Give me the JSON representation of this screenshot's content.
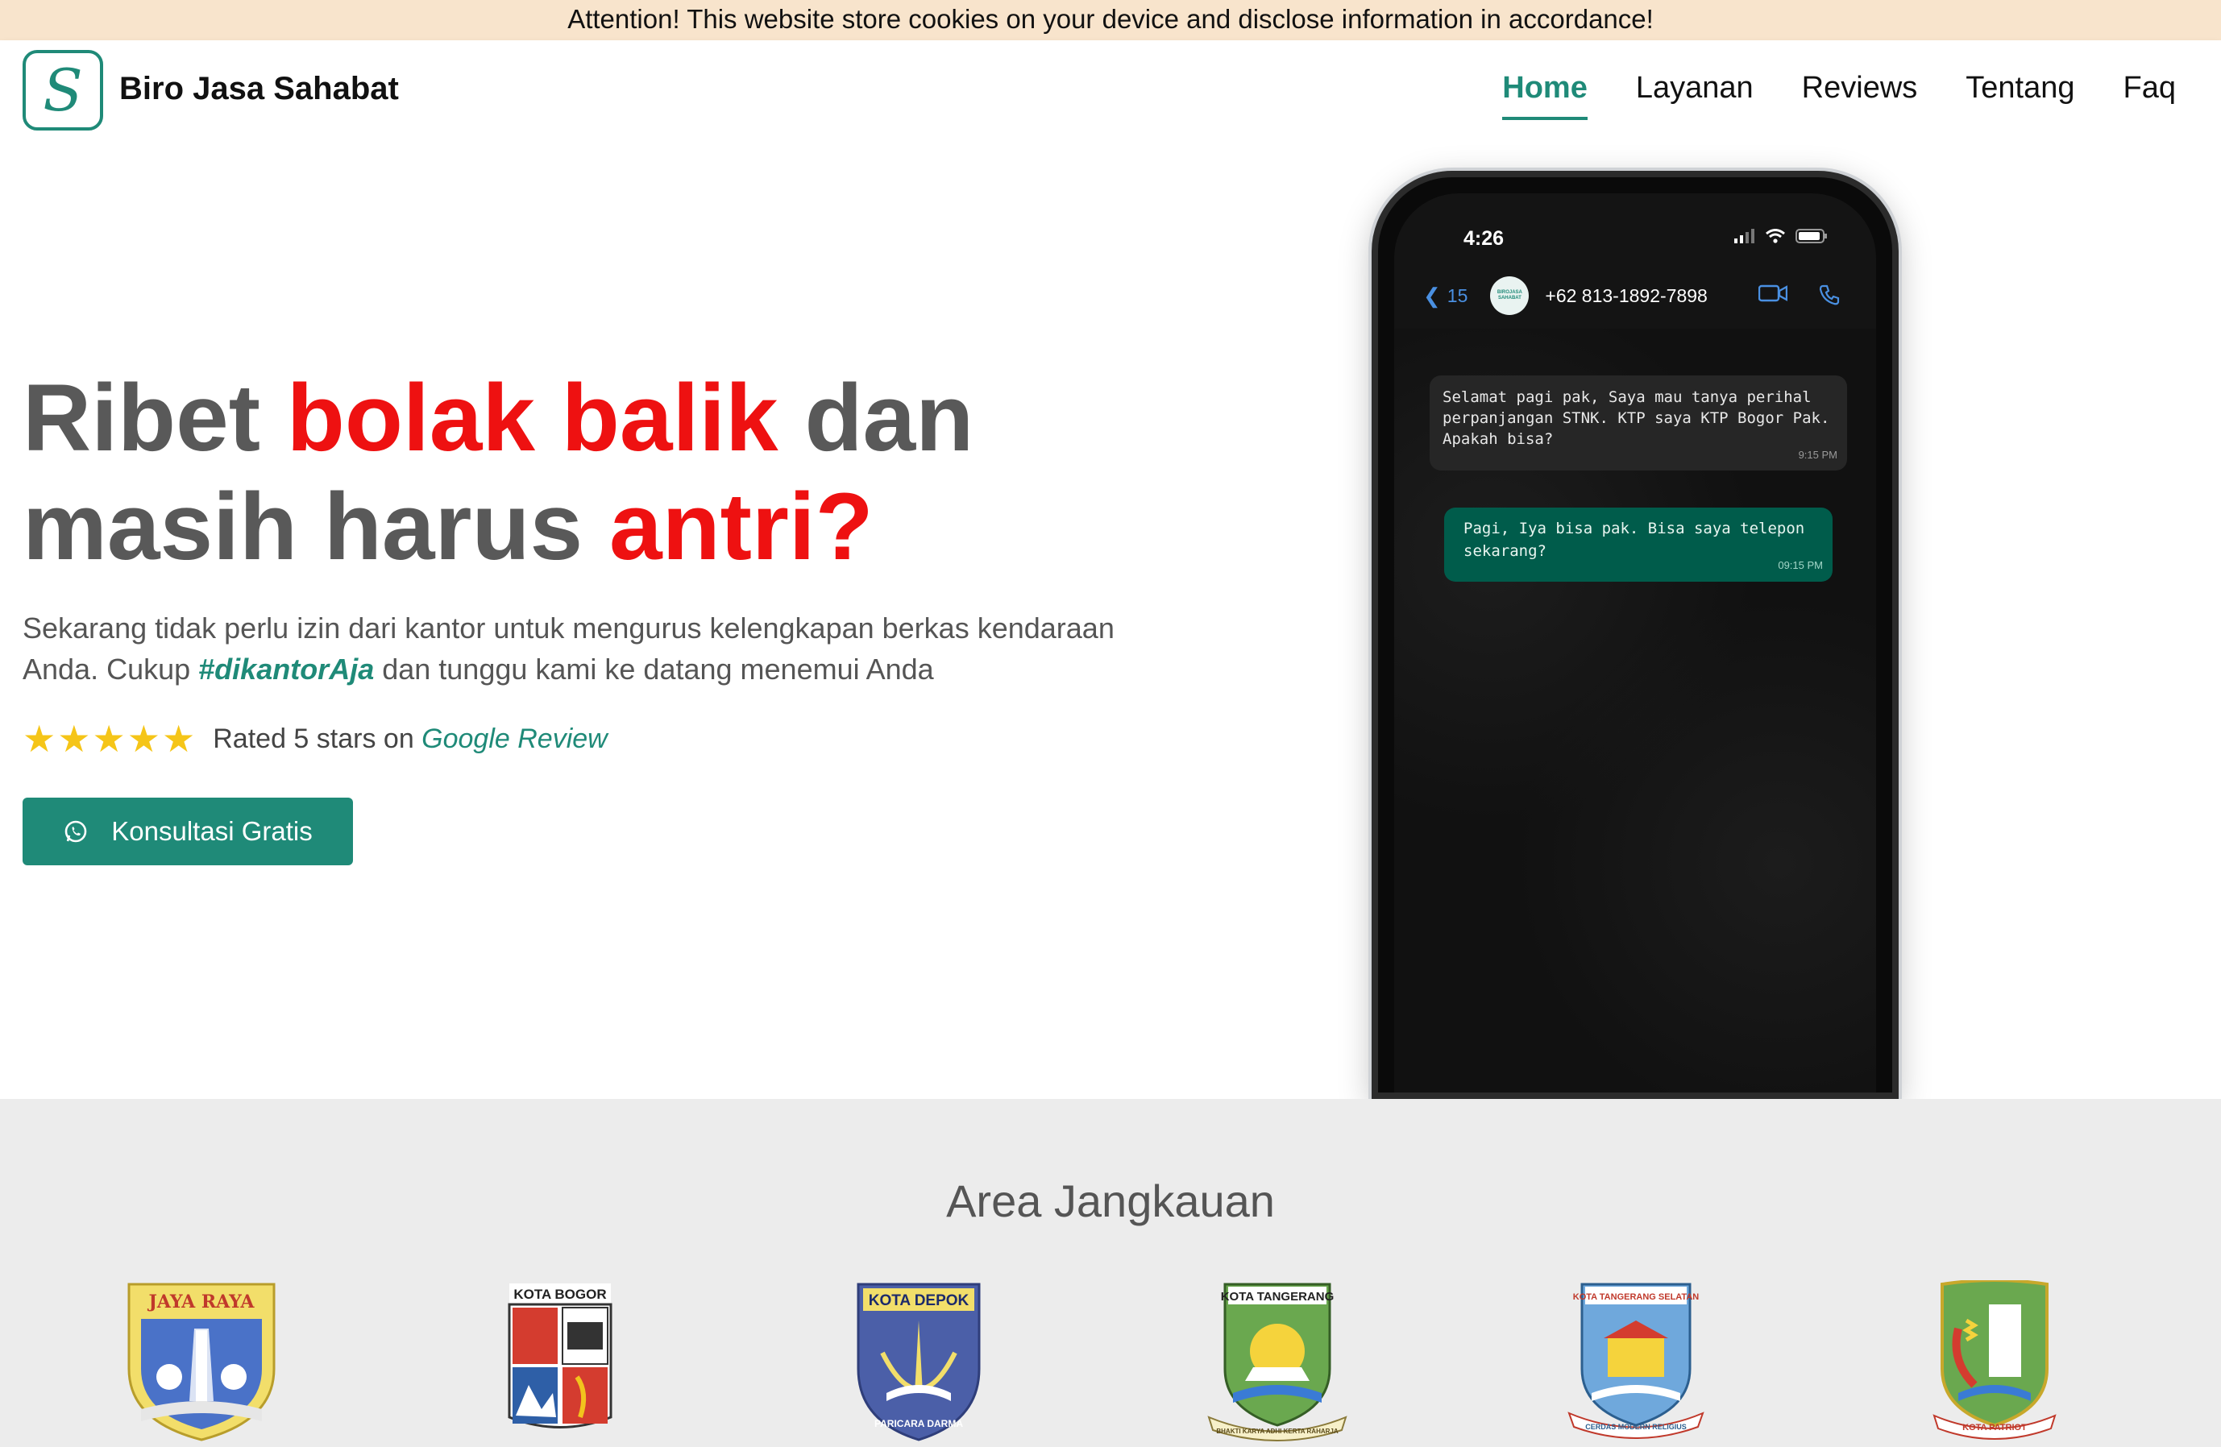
{
  "cookie_bar": {
    "text": "Attention! This website store cookies on your device and disclose information in accordance!"
  },
  "header": {
    "logo_letter": "S",
    "brand": "Biro Jasa Sahabat",
    "nav": [
      {
        "label": "Home",
        "active": true
      },
      {
        "label": "Layanan",
        "active": false
      },
      {
        "label": "Reviews",
        "active": false
      },
      {
        "label": "Tentang",
        "active": false
      },
      {
        "label": "Faq",
        "active": false
      }
    ]
  },
  "hero": {
    "headline_part1": "Ribet ",
    "headline_red1": "bolak balik",
    "headline_part2": " dan masih harus ",
    "headline_red2": "antri?",
    "subtext_part1": "Sekarang tidak perlu izin dari kantor untuk mengurus kelengkapan berkas kendaraan Anda. Cukup ",
    "subtext_tag": "#dikantorAja",
    "subtext_part2": " dan tunggu kami ke datang menemui Anda",
    "rating_stars": 5,
    "rated_prefix": "Rated 5 stars on ",
    "rated_link": "Google Review",
    "cta_label": "Konsultasi Gratis"
  },
  "phone": {
    "status_time": "4:26",
    "back_count": "15",
    "contact": "+62 813-1892-7898",
    "avatar_label": "BIROJASA SAHABAT",
    "message_in": "Selamat pagi pak, Saya mau tanya perihal perpanjangan STNK. KTP saya KTP Bogor Pak. Apakah bisa?",
    "message_in_time": "9:15 PM",
    "message_out": "Pagi, Iya bisa pak. Bisa saya telepon sekarang?",
    "message_out_time": "09:15 PM"
  },
  "area": {
    "title": "Area Jangkauan",
    "emblems": [
      {
        "label": "JAYA RAYA"
      },
      {
        "label": "KOTA BOGOR"
      },
      {
        "label": "KOTA DEPOK",
        "motto": "PARICARA DARMA"
      },
      {
        "label": "KOTA TANGERANG",
        "motto": "BHAKTI KARYA ADHI KERTA RAHARJA"
      },
      {
        "label": "KOTA TANGERANG SELATAN",
        "motto": "CERDAS MODERN RELIGIUS"
      },
      {
        "label": "",
        "motto": "KOTA PATRIOT"
      }
    ]
  }
}
